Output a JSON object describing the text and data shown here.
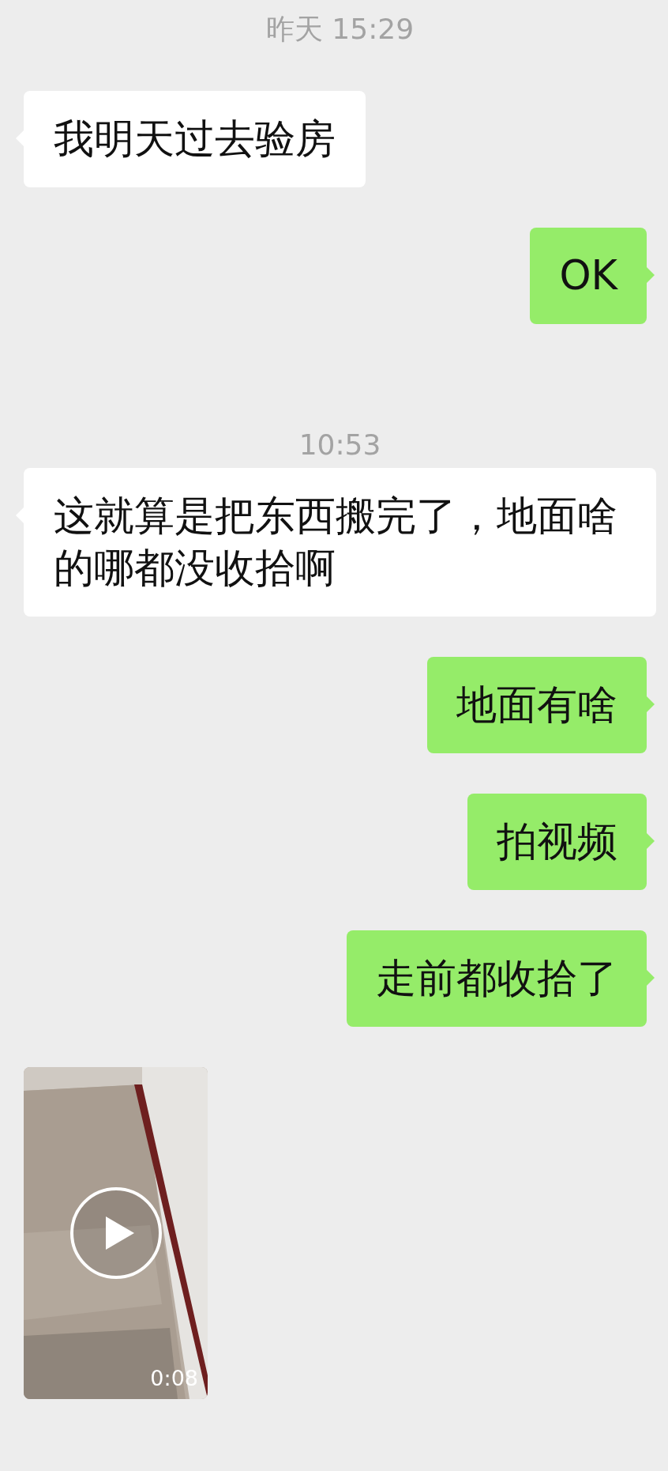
{
  "messages": [
    {
      "kind": "timestamp",
      "text": "昨天 15:29"
    },
    {
      "kind": "incoming",
      "text": "我明天过去验房"
    },
    {
      "kind": "outgoing",
      "text": "OK"
    },
    {
      "kind": "timestamp",
      "text": "10:53"
    },
    {
      "kind": "incoming",
      "text": "这就算是把东西搬完了，地面啥的哪都没收拾啊"
    },
    {
      "kind": "outgoing",
      "text": "地面有啥"
    },
    {
      "kind": "outgoing",
      "text": "拍视频"
    },
    {
      "kind": "outgoing",
      "text": "走前都收拾了"
    },
    {
      "kind": "incoming_video",
      "duration": "0:08"
    }
  ]
}
